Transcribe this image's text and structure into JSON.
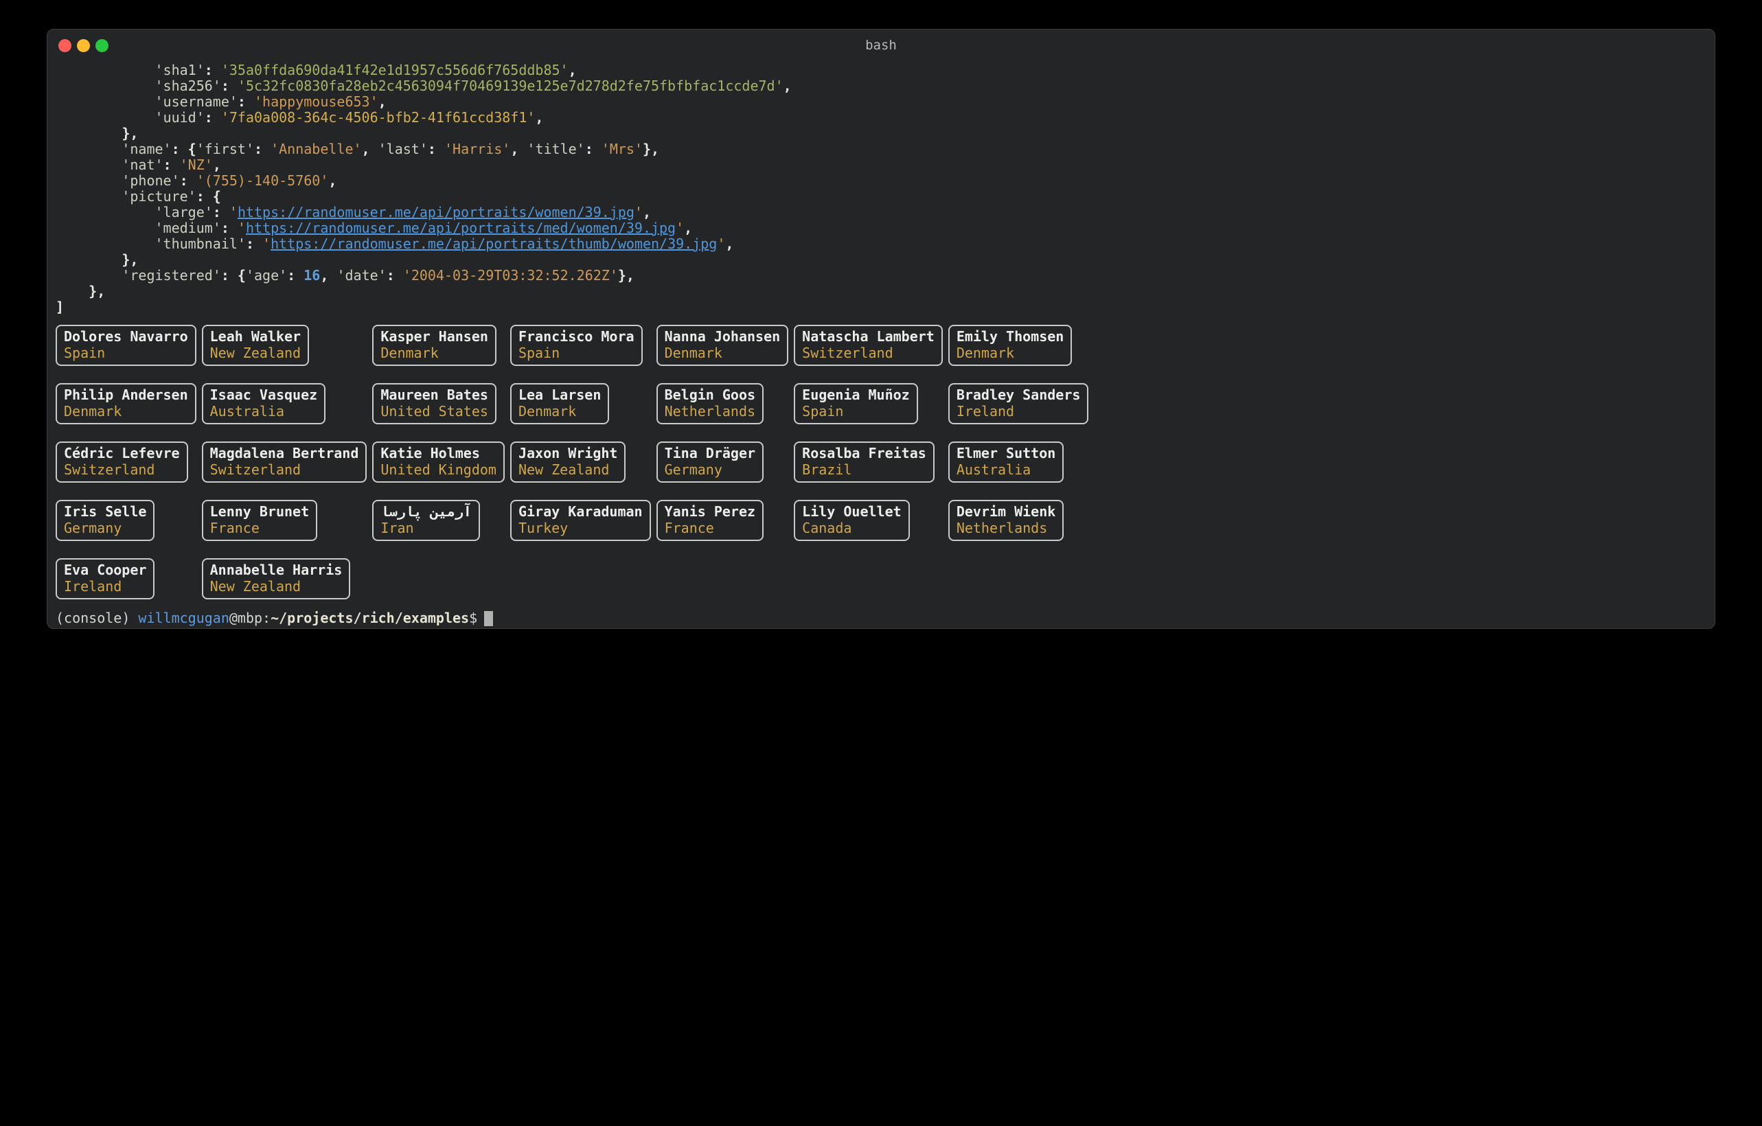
{
  "window": {
    "title": "bash"
  },
  "colors": {
    "terminal_bg": "#232527",
    "titlebar_text": "#b6bab6",
    "punct": "#e8e8e4",
    "key": "#ced0c4",
    "string": "#cf9b57",
    "green": "#a6b465",
    "uuid": "#d8b04a",
    "number": "#5fa0dc",
    "url": "#4f97dc",
    "panel_border": "#c9cbc9",
    "panel_name": "#ededeb",
    "panel_country": "#d2a74b",
    "prompt_text": "#d6d6d2",
    "prompt_user": "#5f9bdf",
    "prompt_path": "#e8e4d4",
    "cursor": "#b0b2b0",
    "traffic_red": "#ff5f57",
    "traffic_yellow": "#febc2e",
    "traffic_green": "#28c840"
  },
  "terminal": {
    "lines": [
      [
        {
          "t": "            ",
          "c": "p"
        },
        {
          "t": "'sha1'",
          "c": "k"
        },
        {
          "t": ": ",
          "c": "p"
        },
        {
          "t": "'35a0ffda690da41f42e1d1957c556d6f765ddb85'",
          "c": "g"
        },
        {
          "t": ",",
          "c": "p"
        }
      ],
      [
        {
          "t": "            ",
          "c": "p"
        },
        {
          "t": "'sha256'",
          "c": "k"
        },
        {
          "t": ": ",
          "c": "p"
        },
        {
          "t": "'5c32fc0830fa28eb2c4563094f70469139e125e7d278d2fe75fbfbfac1ccde7d'",
          "c": "g"
        },
        {
          "t": ",",
          "c": "p"
        }
      ],
      [
        {
          "t": "            ",
          "c": "p"
        },
        {
          "t": "'username'",
          "c": "k"
        },
        {
          "t": ": ",
          "c": "p"
        },
        {
          "t": "'happymouse653'",
          "c": "s"
        },
        {
          "t": ",",
          "c": "p"
        }
      ],
      [
        {
          "t": "            ",
          "c": "p"
        },
        {
          "t": "'uuid'",
          "c": "k"
        },
        {
          "t": ": ",
          "c": "p"
        },
        {
          "t": "'7fa0a008-364c-4506-bfb2-41f61ccd38f1'",
          "c": "u"
        },
        {
          "t": ",",
          "c": "p"
        }
      ],
      [
        {
          "t": "        ",
          "c": "p"
        },
        {
          "t": "},",
          "c": "p"
        }
      ],
      [
        {
          "t": "        ",
          "c": "p"
        },
        {
          "t": "'name'",
          "c": "k"
        },
        {
          "t": ": {",
          "c": "p"
        },
        {
          "t": "'first'",
          "c": "k"
        },
        {
          "t": ": ",
          "c": "p"
        },
        {
          "t": "'Annabelle'",
          "c": "s"
        },
        {
          "t": ", ",
          "c": "p"
        },
        {
          "t": "'last'",
          "c": "k"
        },
        {
          "t": ": ",
          "c": "p"
        },
        {
          "t": "'Harris'",
          "c": "s"
        },
        {
          "t": ", ",
          "c": "p"
        },
        {
          "t": "'title'",
          "c": "k"
        },
        {
          "t": ": ",
          "c": "p"
        },
        {
          "t": "'Mrs'",
          "c": "s"
        },
        {
          "t": "},",
          "c": "p"
        }
      ],
      [
        {
          "t": "        ",
          "c": "p"
        },
        {
          "t": "'nat'",
          "c": "k"
        },
        {
          "t": ": ",
          "c": "p"
        },
        {
          "t": "'NZ'",
          "c": "s"
        },
        {
          "t": ",",
          "c": "p"
        }
      ],
      [
        {
          "t": "        ",
          "c": "p"
        },
        {
          "t": "'phone'",
          "c": "k"
        },
        {
          "t": ": ",
          "c": "p"
        },
        {
          "t": "'(755)-140-5760'",
          "c": "s"
        },
        {
          "t": ",",
          "c": "p"
        }
      ],
      [
        {
          "t": "        ",
          "c": "p"
        },
        {
          "t": "'picture'",
          "c": "k"
        },
        {
          "t": ": {",
          "c": "p"
        }
      ],
      [
        {
          "t": "            ",
          "c": "p"
        },
        {
          "t": "'large'",
          "c": "k"
        },
        {
          "t": ": ",
          "c": "p"
        },
        {
          "t": "'",
          "c": "s"
        },
        {
          "t": "https://randomuser.me/api/portraits/women/39.jpg",
          "c": "url"
        },
        {
          "t": "'",
          "c": "s"
        },
        {
          "t": ",",
          "c": "p"
        }
      ],
      [
        {
          "t": "            ",
          "c": "p"
        },
        {
          "t": "'medium'",
          "c": "k"
        },
        {
          "t": ": ",
          "c": "p"
        },
        {
          "t": "'",
          "c": "s"
        },
        {
          "t": "https://randomuser.me/api/portraits/med/women/39.jpg",
          "c": "url"
        },
        {
          "t": "'",
          "c": "s"
        },
        {
          "t": ",",
          "c": "p"
        }
      ],
      [
        {
          "t": "            ",
          "c": "p"
        },
        {
          "t": "'thumbnail'",
          "c": "k"
        },
        {
          "t": ": ",
          "c": "p"
        },
        {
          "t": "'",
          "c": "s"
        },
        {
          "t": "https://randomuser.me/api/portraits/thumb/women/39.jpg",
          "c": "url"
        },
        {
          "t": "'",
          "c": "s"
        },
        {
          "t": ",",
          "c": "p"
        }
      ],
      [
        {
          "t": "        ",
          "c": "p"
        },
        {
          "t": "},",
          "c": "p"
        }
      ],
      [
        {
          "t": "        ",
          "c": "p"
        },
        {
          "t": "'registered'",
          "c": "k"
        },
        {
          "t": ": {",
          "c": "p"
        },
        {
          "t": "'age'",
          "c": "k"
        },
        {
          "t": ": ",
          "c": "p"
        },
        {
          "t": "16",
          "c": "n"
        },
        {
          "t": ", ",
          "c": "p"
        },
        {
          "t": "'date'",
          "c": "k"
        },
        {
          "t": ": ",
          "c": "p"
        },
        {
          "t": "'2004-03-29T03:32:52.262Z'",
          "c": "s"
        },
        {
          "t": "},",
          "c": "p"
        }
      ],
      [
        {
          "t": "    ",
          "c": "p"
        },
        {
          "t": "},",
          "c": "p"
        }
      ],
      [
        {
          "t": "]",
          "c": "p"
        }
      ]
    ]
  },
  "panels": {
    "rows": [
      [
        {
          "name": "Dolores Navarro",
          "country": "Spain"
        },
        {
          "name": "Leah Walker",
          "country": "New Zealand"
        },
        {
          "name": "Kasper Hansen",
          "country": "Denmark"
        },
        {
          "name": "Francisco Mora",
          "country": "Spain"
        },
        {
          "name": "Nanna Johansen",
          "country": "Denmark"
        },
        {
          "name": "Natascha Lambert",
          "country": "Switzerland"
        },
        {
          "name": "Emily Thomsen",
          "country": "Denmark"
        }
      ],
      [
        {
          "name": "Philip Andersen",
          "country": "Denmark"
        },
        {
          "name": "Isaac Vasquez",
          "country": "Australia"
        },
        {
          "name": "Maureen Bates",
          "country": "United States"
        },
        {
          "name": "Lea Larsen",
          "country": "Denmark"
        },
        {
          "name": "Belgin Goos",
          "country": "Netherlands"
        },
        {
          "name": "Eugenia Muñoz",
          "country": "Spain"
        },
        {
          "name": "Bradley Sanders",
          "country": "Ireland"
        }
      ],
      [
        {
          "name": "Cédric Lefevre",
          "country": "Switzerland"
        },
        {
          "name": "Magdalena Bertrand",
          "country": "Switzerland"
        },
        {
          "name": "Katie Holmes",
          "country": "United Kingdom"
        },
        {
          "name": "Jaxon Wright",
          "country": "New Zealand"
        },
        {
          "name": "Tina Dräger",
          "country": "Germany"
        },
        {
          "name": "Rosalba Freitas",
          "country": "Brazil"
        },
        {
          "name": "Elmer Sutton",
          "country": "Australia"
        }
      ],
      [
        {
          "name": "Iris Selle",
          "country": "Germany"
        },
        {
          "name": "Lenny Brunet",
          "country": "France"
        },
        {
          "name": "آرمین پارسا",
          "country": "Iran"
        },
        {
          "name": "Giray Karaduman",
          "country": "Turkey"
        },
        {
          "name": "Yanis Perez",
          "country": "France"
        },
        {
          "name": "Lily Ouellet",
          "country": "Canada"
        },
        {
          "name": "Devrim Wienk",
          "country": "Netherlands"
        }
      ],
      [
        {
          "name": "Eva Cooper",
          "country": "Ireland"
        },
        {
          "name": "Annabelle Harris",
          "country": "New Zealand"
        }
      ]
    ]
  },
  "prompt": {
    "venv": "(console) ",
    "user": "willmcgugan",
    "host": "@mbp:",
    "path": "~/projects/rich/examples",
    "dollar": "$"
  }
}
